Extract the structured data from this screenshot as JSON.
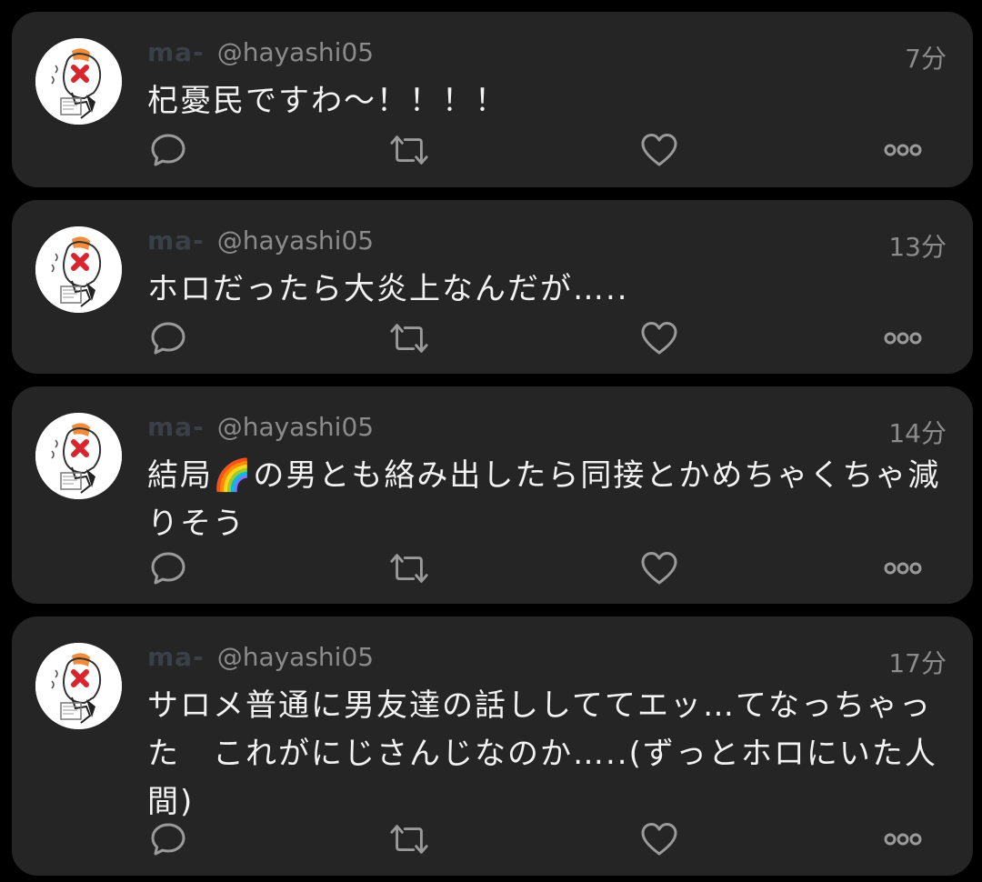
{
  "tweets": [
    {
      "display_name": "ma-",
      "handle": "@hayashi05",
      "time": "7分",
      "text": "杞憂民ですわ〜！！！！"
    },
    {
      "display_name": "ma-",
      "handle": "@hayashi05",
      "time": "13分",
      "text": "ホロだったら大炎上なんだが….."
    },
    {
      "display_name": "ma-",
      "handle": "@hayashi05",
      "time": "14分",
      "text": "結局🌈の男とも絡み出したら同接とかめちゃくちゃ減りそう"
    },
    {
      "display_name": "ma-",
      "handle": "@hayashi05",
      "time": "17分",
      "text": "サロメ普通に男友達の話ししててエッ…てなっちゃった　これがにじさんじなのか…..(ずっとホロにいた人間)"
    }
  ],
  "icons": {
    "avatar": "avatar",
    "reply": "reply-icon",
    "retweet": "retweet-icon",
    "like": "heart-icon",
    "more": "more-icon"
  },
  "colors": {
    "background": "#000000",
    "card": "#252525",
    "text": "#f2f2f2",
    "muted": "#8b8b8b",
    "display_name": "#3b3f47",
    "icon": "#9a9a9a"
  }
}
